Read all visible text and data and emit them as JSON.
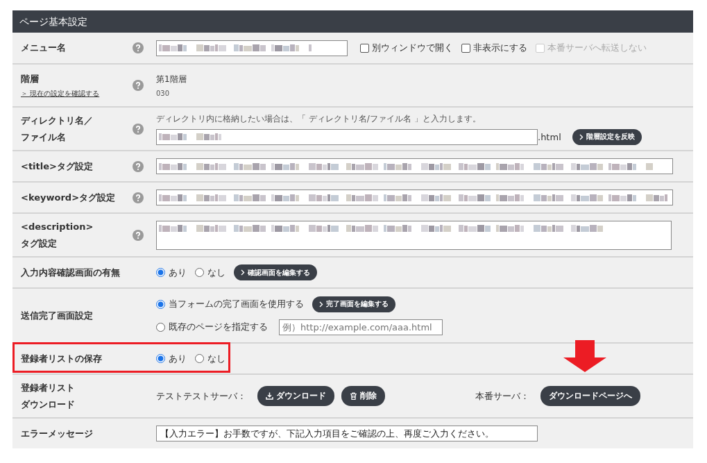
{
  "panel": {
    "title": "ページ基本設定"
  },
  "rows": [
    {
      "kind": "menu_name",
      "label": "メニュー名",
      "help": true,
      "field": {
        "redacted": true
      },
      "checkboxes": [
        {
          "label": "別ウィンドウで開く",
          "checked": false,
          "disabled": false
        },
        {
          "label": "非表示にする",
          "checked": false,
          "disabled": false
        },
        {
          "label": "本番サーバへ転送しない",
          "checked": false,
          "disabled": true
        }
      ]
    },
    {
      "kind": "hierarchy",
      "label": "階層",
      "link": "＞ 現在の設定を確認する",
      "help": true,
      "value": "第1階層",
      "sub": "030"
    },
    {
      "kind": "directory",
      "label_lines": [
        "ディレクトリ名／",
        "ファイル名"
      ],
      "help": true,
      "hint": "ディレクトリ内に格納したい場合は、「 ディレクトリ名/ファイル名 」と入力します。",
      "field": {
        "redacted": true
      },
      "suffix": ".html",
      "button": "階層設定を反映"
    },
    {
      "kind": "text",
      "label": "<title>タグ設定",
      "help": true,
      "field": {
        "redacted": true
      }
    },
    {
      "kind": "text",
      "label": "<keyword>タグ設定",
      "help": true,
      "field": {
        "redacted": true
      }
    },
    {
      "kind": "textarea",
      "label_lines": [
        "<description>",
        "タグ設定"
      ],
      "help": true,
      "field": {
        "redacted": true
      }
    },
    {
      "kind": "radios",
      "label": "入力内容確認画面の有無",
      "options": [
        {
          "label": "あり",
          "selected": true
        },
        {
          "label": "なし",
          "selected": false
        }
      ],
      "button": "確認画面を編集する"
    },
    {
      "kind": "completion",
      "label": "送信完了画面設定",
      "options": [
        {
          "label": "当フォームの完了画面を使用する",
          "selected": true,
          "button": "完了画面を編集する"
        },
        {
          "label": "既存のページを指定する",
          "selected": false,
          "placeholder": "例）http://example.com/aaa.html"
        }
      ]
    },
    {
      "kind": "radios",
      "label": "登録者リストの保存",
      "highlighted": true,
      "options": [
        {
          "label": "あり",
          "selected": true
        },
        {
          "label": "なし",
          "selected": false
        }
      ]
    },
    {
      "kind": "download",
      "label_lines": [
        "登録者リスト",
        "ダウンロード"
      ],
      "test_label": "テストテストサーバ：",
      "buttons": [
        {
          "kind": "download",
          "label": "ダウンロード"
        },
        {
          "kind": "delete",
          "label": "削除"
        }
      ],
      "prod_label": "本番サーバ：",
      "prod_button": {
        "label": "ダウンロードページへ",
        "pointed_at": true
      }
    },
    {
      "kind": "text",
      "label": "エラーメッセージ",
      "field": {
        "value": "【入力エラー】お手数ですが、下記入力項目をご確認の上、再度ご入力ください。"
      }
    }
  ]
}
